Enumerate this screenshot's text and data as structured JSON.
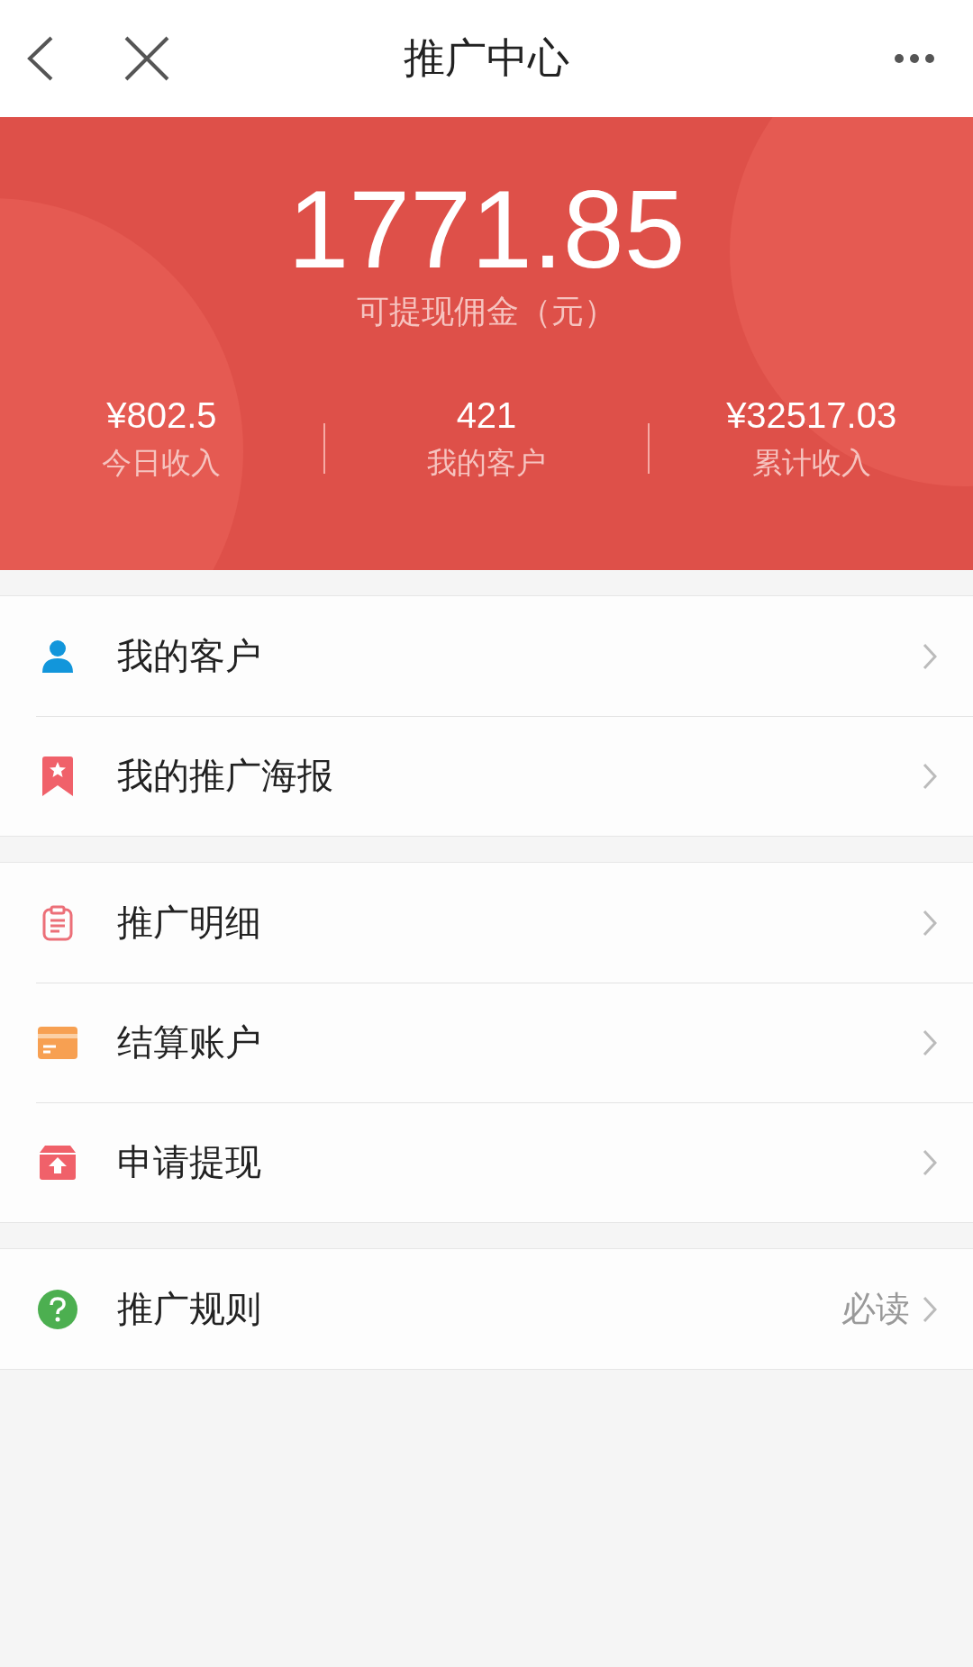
{
  "header": {
    "title": "推广中心"
  },
  "balance": {
    "amount": "1771.85",
    "label": "可提现佣金（元）"
  },
  "stats": [
    {
      "value": "¥802.5",
      "label": "今日收入"
    },
    {
      "value": "421",
      "label": "我的客户"
    },
    {
      "value": "¥32517.03",
      "label": "累计收入"
    }
  ],
  "sections": [
    {
      "items": [
        {
          "label": "我的客户"
        },
        {
          "label": "我的推广海报"
        }
      ]
    },
    {
      "items": [
        {
          "label": "推广明细"
        },
        {
          "label": "结算账户"
        },
        {
          "label": "申请提现"
        }
      ]
    },
    {
      "items": [
        {
          "label": "推广规则",
          "note": "必读"
        }
      ]
    }
  ]
}
